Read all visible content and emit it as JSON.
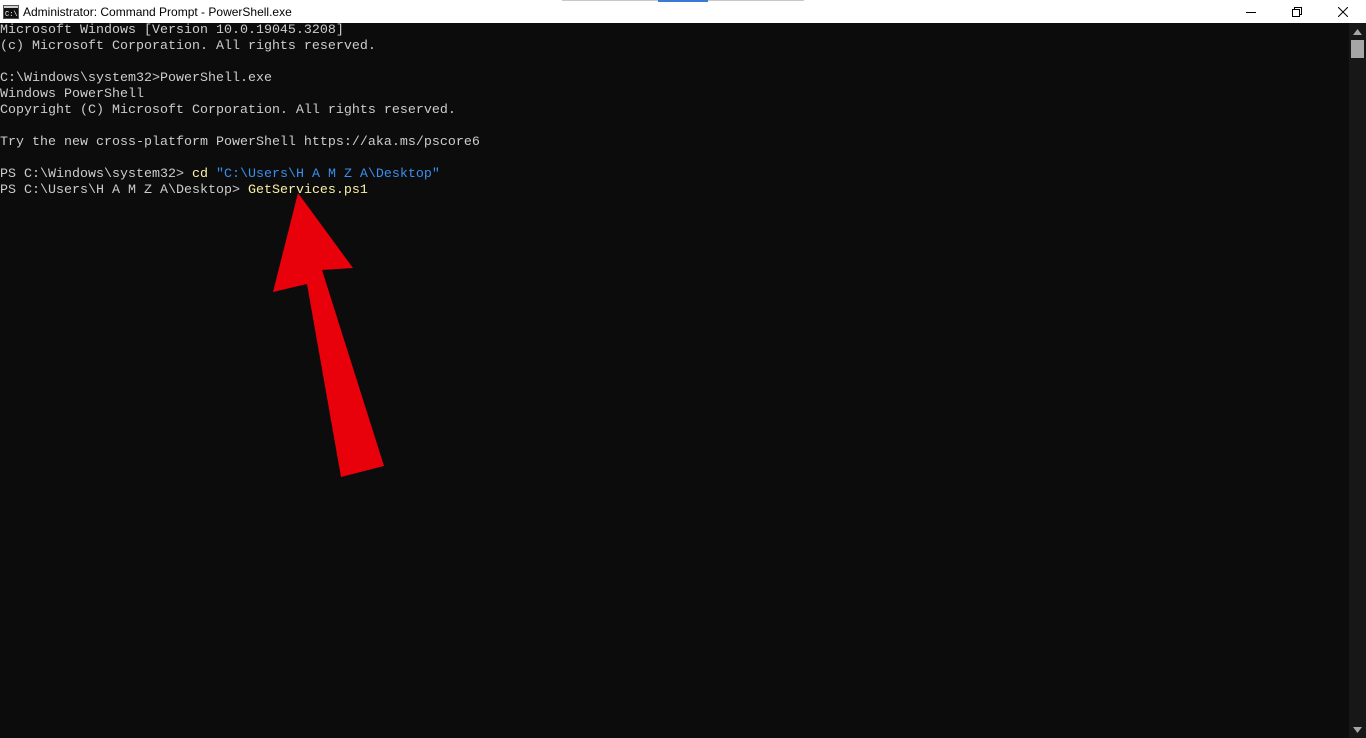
{
  "window": {
    "title": "Administrator: Command Prompt - PowerShell.exe",
    "icon": "cmd-icon",
    "controls": {
      "minimize": "minimize-icon",
      "maximize": "restore-icon",
      "close": "close-icon"
    }
  },
  "console": {
    "lines": [
      "Microsoft Windows [Version 10.0.19045.3208]",
      "(c) Microsoft Corporation. All rights reserved.",
      "",
      "C:\\Windows\\system32>PowerShell.exe",
      "Windows PowerShell",
      "Copyright (C) Microsoft Corporation. All rights reserved.",
      "",
      "Try the new cross-platform PowerShell https://aka.ms/pscore6",
      ""
    ],
    "prompt1": {
      "prefix": "PS C:\\Windows\\system32> ",
      "command": "cd",
      "argument": "\"C:\\Users\\H A M Z A\\Desktop\""
    },
    "prompt2": {
      "prefix": "PS C:\\Users\\H A M Z A\\Desktop> ",
      "command": "GetServices.ps1"
    }
  },
  "annotation": {
    "type": "arrow",
    "color": "#e8000b"
  },
  "colors": {
    "background": "#0c0c0c",
    "text": "#cccccc",
    "command": "#f9f1a5",
    "string": "#3b8eea"
  }
}
